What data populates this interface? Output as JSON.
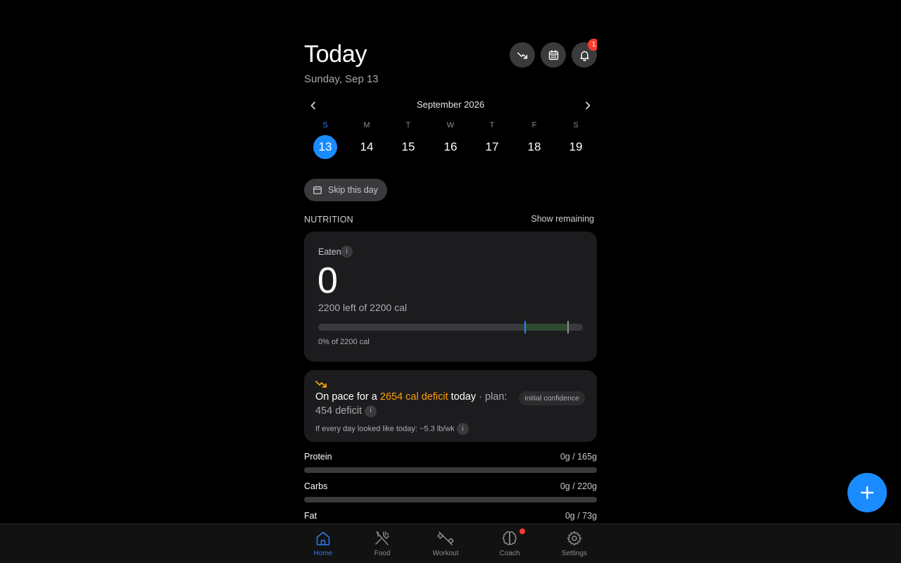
{
  "header": {
    "title": "Today",
    "subtitle": "Sunday, Sep 13",
    "actions": [
      {
        "name": "trend-button",
        "icon": "trend-down-icon"
      },
      {
        "name": "calendar-button",
        "icon": "calendar-icon"
      },
      {
        "name": "notifications-button",
        "icon": "bell-icon",
        "badge": "1"
      }
    ]
  },
  "calendar": {
    "month_label": "September 2026",
    "weekdays": [
      "S",
      "M",
      "T",
      "W",
      "T",
      "F",
      "S"
    ],
    "dates": [
      "13",
      "14",
      "15",
      "16",
      "17",
      "18",
      "19"
    ],
    "selected_index": 0
  },
  "skip_label": "Skip this day",
  "nutrition": {
    "section_label": "NUTRITION",
    "toggle_label": "Show remaining",
    "eaten_label": "Eaten",
    "info_glyph": "i",
    "eaten_value": "0",
    "left_text": "2200 left of 2200 cal",
    "percent_text": "0% of 2200 cal",
    "progress_fraction": 0
  },
  "pace": {
    "prefix": "On pace for a ",
    "highlight": "2654 cal deficit",
    "suffix": " today",
    "plan_text": " · plan: 454 deficit",
    "confidence": "initial confidence",
    "footnote": "If every day looked like today: −5.3 lb/wk"
  },
  "macros": [
    {
      "name": "Protein",
      "value": "0g / 165g",
      "fraction": 0
    },
    {
      "name": "Carbs",
      "value": "0g / 220g",
      "fraction": 0
    },
    {
      "name": "Fat",
      "value": "0g / 73g",
      "fraction": 0
    }
  ],
  "tabs": [
    {
      "label": "Home",
      "icon": "home-icon",
      "active": true
    },
    {
      "label": "Food",
      "icon": "utensils-icon"
    },
    {
      "label": "Workout",
      "icon": "dumbbell-icon"
    },
    {
      "label": "Coach",
      "icon": "brain-icon",
      "dot": true
    },
    {
      "label": "Settings",
      "icon": "gear-icon"
    }
  ],
  "colors": {
    "accent": "#1a8cff",
    "warning": "#ff9f0a",
    "badge": "#ff3b30",
    "card": "#1c1c1e"
  }
}
